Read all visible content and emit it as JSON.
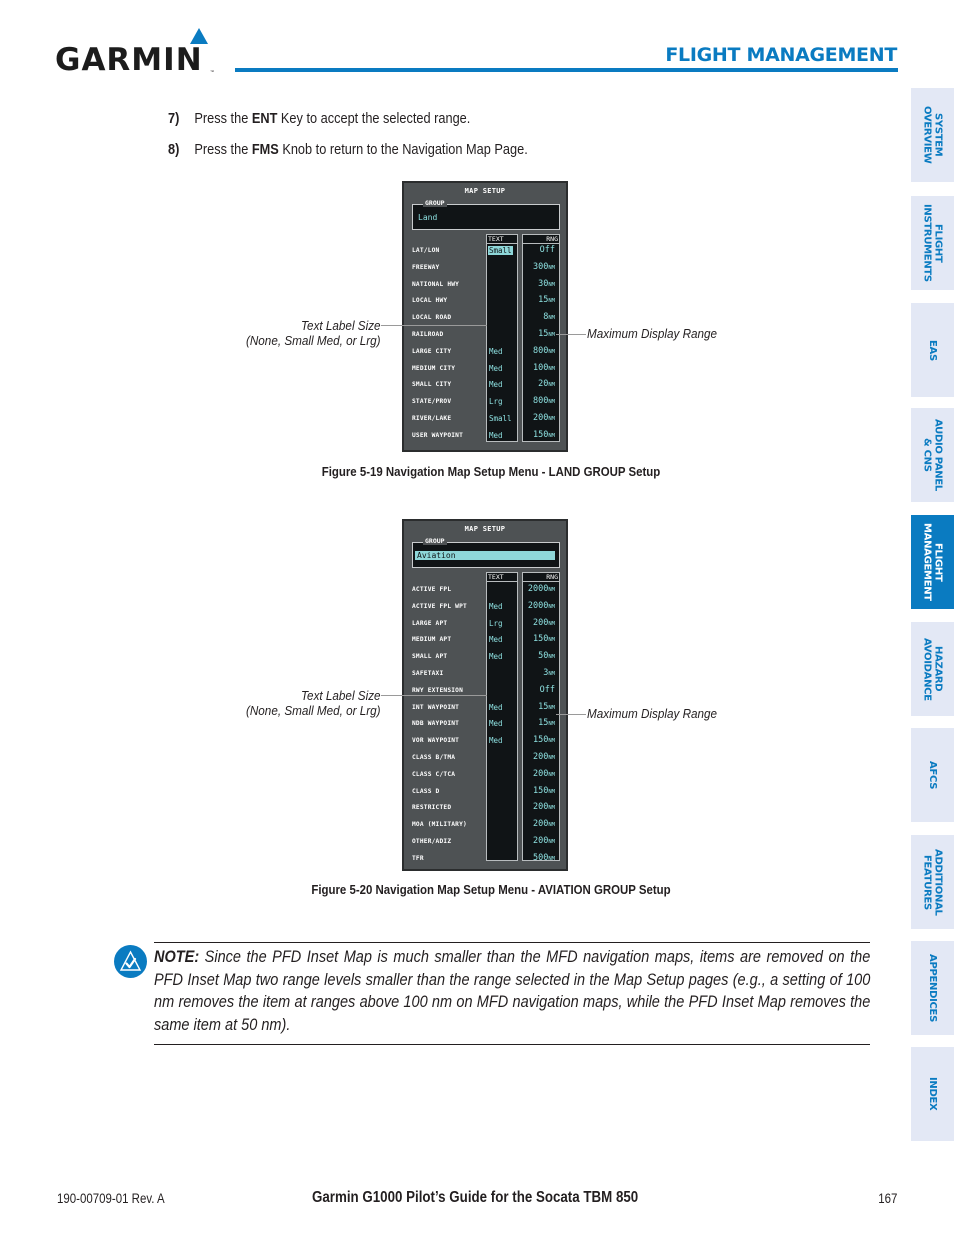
{
  "header": {
    "brand": "GARMIN",
    "trademark": "™",
    "section_title": "FLIGHT MANAGEMENT",
    "accent_color": "#0a7bc1"
  },
  "side_tabs": [
    {
      "label": "SYSTEM\nOVERVIEW",
      "active": false
    },
    {
      "label": "FLIGHT\nINSTRUMENTS",
      "active": false
    },
    {
      "label": "EAS",
      "active": false
    },
    {
      "label": "AUDIO PANEL\n& CNS",
      "active": false
    },
    {
      "label": "FLIGHT\nMANAGEMENT",
      "active": true
    },
    {
      "label": "HAZARD\nAVOIDANCE",
      "active": false
    },
    {
      "label": "AFCS",
      "active": false
    },
    {
      "label": "ADDITIONAL\nFEATURES",
      "active": false
    },
    {
      "label": "APPENDICES",
      "active": false
    },
    {
      "label": "INDEX",
      "active": false
    }
  ],
  "steps": [
    {
      "num": "7)",
      "pre": "Press the ",
      "key": "ENT",
      "post": " Key to accept the selected range."
    },
    {
      "num": "8)",
      "pre": "Press the ",
      "key": "FMS",
      "post": " Knob to return to the Navigation Map Page."
    }
  ],
  "figures": [
    {
      "panel_title": "MAP SETUP",
      "group_label": "GROUP",
      "group_value": "Land",
      "group_selected": false,
      "text_header": "TEXT",
      "rng_header": "RNG",
      "rows": [
        {
          "label": "LAT/LON",
          "text": "Small",
          "text_selected": true,
          "rng": "Off",
          "unit": ""
        },
        {
          "label": "FREEWAY",
          "text": "",
          "text_selected": false,
          "rng": "300",
          "unit": "NM"
        },
        {
          "label": "NATIONAL HWY",
          "text": "",
          "text_selected": false,
          "rng": "30",
          "unit": "NM"
        },
        {
          "label": "LOCAL HWY",
          "text": "",
          "text_selected": false,
          "rng": "15",
          "unit": "NM"
        },
        {
          "label": "LOCAL ROAD",
          "text": "",
          "text_selected": false,
          "rng": "8",
          "unit": "NM"
        },
        {
          "label": "RAILROAD",
          "text": "",
          "text_selected": false,
          "rng": "15",
          "unit": "NM"
        },
        {
          "label": "LARGE CITY",
          "text": "Med",
          "text_selected": false,
          "rng": "800",
          "unit": "NM"
        },
        {
          "label": "MEDIUM CITY",
          "text": "Med",
          "text_selected": false,
          "rng": "100",
          "unit": "NM"
        },
        {
          "label": "SMALL CITY",
          "text": "Med",
          "text_selected": false,
          "rng": "20",
          "unit": "NM"
        },
        {
          "label": "STATE/PROV",
          "text": "Lrg",
          "text_selected": false,
          "rng": "800",
          "unit": "NM"
        },
        {
          "label": "RIVER/LAKE",
          "text": "Small",
          "text_selected": false,
          "rng": "200",
          "unit": "NM"
        },
        {
          "label": "USER WAYPOINT",
          "text": "Med",
          "text_selected": false,
          "rng": "150",
          "unit": "NM"
        }
      ],
      "callout_left_line1": "Text Label Size",
      "callout_left_line2": "(None, Small Med, or Lrg)",
      "callout_right": "Maximum Display Range",
      "caption": "Figure 5-19  Navigation Map Setup Menu - LAND GROUP Setup"
    },
    {
      "panel_title": "MAP SETUP",
      "group_label": "GROUP",
      "group_value": "Aviation",
      "group_selected": true,
      "text_header": "TEXT",
      "rng_header": "RNG",
      "rows": [
        {
          "label": "ACTIVE FPL",
          "text": "",
          "text_selected": false,
          "rng": "2000",
          "unit": "NM"
        },
        {
          "label": "ACTIVE FPL WPT",
          "text": "Med",
          "text_selected": false,
          "rng": "2000",
          "unit": "NM"
        },
        {
          "label": "LARGE APT",
          "text": "Lrg",
          "text_selected": false,
          "rng": "200",
          "unit": "NM"
        },
        {
          "label": "MEDIUM APT",
          "text": "Med",
          "text_selected": false,
          "rng": "150",
          "unit": "NM"
        },
        {
          "label": "SMALL APT",
          "text": "Med",
          "text_selected": false,
          "rng": "50",
          "unit": "NM"
        },
        {
          "label": "SAFETAXI",
          "text": "",
          "text_selected": false,
          "rng": "3",
          "unit": "NM"
        },
        {
          "label": "RWY EXTENSION",
          "text": "",
          "text_selected": false,
          "rng": "Off",
          "unit": ""
        },
        {
          "label": "INT WAYPOINT",
          "text": "Med",
          "text_selected": false,
          "rng": "15",
          "unit": "NM"
        },
        {
          "label": "NDB WAYPOINT",
          "text": "Med",
          "text_selected": false,
          "rng": "15",
          "unit": "NM"
        },
        {
          "label": "VOR WAYPOINT",
          "text": "Med",
          "text_selected": false,
          "rng": "150",
          "unit": "NM"
        },
        {
          "label": "CLASS B/TMA",
          "text": "",
          "text_selected": false,
          "rng": "200",
          "unit": "NM"
        },
        {
          "label": "CLASS C/TCA",
          "text": "",
          "text_selected": false,
          "rng": "200",
          "unit": "NM"
        },
        {
          "label": "CLASS D",
          "text": "",
          "text_selected": false,
          "rng": "150",
          "unit": "NM"
        },
        {
          "label": "RESTRICTED",
          "text": "",
          "text_selected": false,
          "rng": "200",
          "unit": "NM"
        },
        {
          "label": "MOA (MILITARY)",
          "text": "",
          "text_selected": false,
          "rng": "200",
          "unit": "NM"
        },
        {
          "label": "OTHER/ADIZ",
          "text": "",
          "text_selected": false,
          "rng": "200",
          "unit": "NM"
        },
        {
          "label": "TFR",
          "text": "",
          "text_selected": false,
          "rng": "500",
          "unit": "NM"
        }
      ],
      "callout_left_line1": "Text Label Size",
      "callout_left_line2": "(None, Small Med, or Lrg)",
      "callout_right": "Maximum Display Range",
      "caption": "Figure 5-20  Navigation Map Setup Menu - AVIATION GROUP Setup"
    }
  ],
  "note": {
    "label": "NOTE:",
    "text": "  Since the PFD Inset Map is much smaller than the MFD navigation maps, items are removed on the PFD Inset Map two range levels smaller than the range selected in the Map Setup pages (e.g., a setting of 100 nm removes the item at ranges above 100 nm on MFD navigation maps, while the PFD Inset Map removes the same item at 50 nm)."
  },
  "footer": {
    "doc_number": "190-00709-01  Rev. A",
    "title": "Garmin G1000 Pilot’s Guide for the Socata TBM 850",
    "page": "167"
  }
}
